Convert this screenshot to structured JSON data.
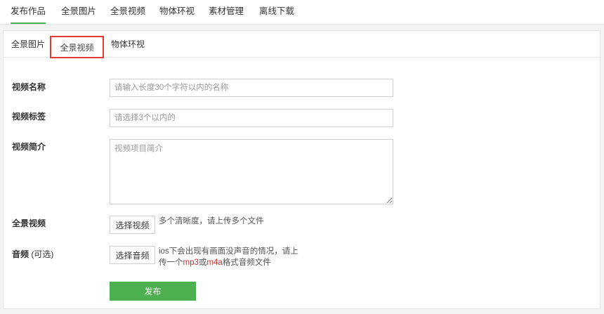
{
  "top_tabs": [
    {
      "label": "发布作品"
    },
    {
      "label": "全景图片"
    },
    {
      "label": "全景视频"
    },
    {
      "label": "物体环视"
    },
    {
      "label": "素材管理"
    },
    {
      "label": "离线下载"
    }
  ],
  "sub_tabs": [
    {
      "label": "全景图片"
    },
    {
      "label": "全景视频"
    },
    {
      "label": "物体环视"
    }
  ],
  "form": {
    "name_label": "视频名称",
    "name_placeholder": "请输入长度30个字符以内的名称",
    "tags_label": "视频标签",
    "tags_placeholder": "请选择3个以内的",
    "intro_label": "视频简介",
    "intro_placeholder": "视频项目简介",
    "video_label": "全景视频",
    "video_button": "选择视频",
    "video_hint": "多个清晰度，请上传多个文件",
    "audio_label": "音频",
    "audio_optional": "(可选)",
    "audio_button": "选择音频",
    "audio_hint_line1": "ios下会出现有画面没声音的情况，请上",
    "audio_hint_prefix": "传一个",
    "audio_hint_fmt1": "mp3",
    "audio_hint_or": "或",
    "audio_hint_fmt2": "m4a",
    "audio_hint_suffix": "格式音频文件",
    "publish_button": "发布"
  },
  "colors": {
    "accent": "#4caf50",
    "active_outline": "#e53935",
    "highlight_text": "#d32f2f"
  }
}
